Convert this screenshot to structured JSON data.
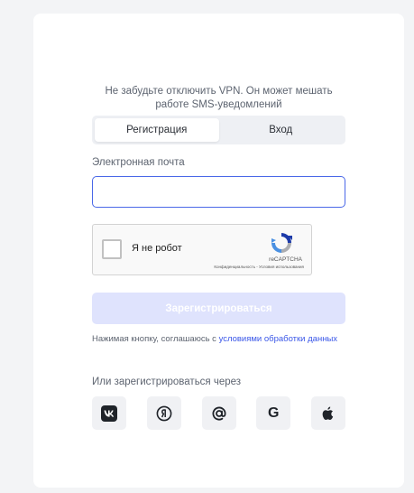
{
  "notice": {
    "line1": "Не забудьте отключить VPN. Он может мешать",
    "line2": "работе SMS-уведомлений"
  },
  "tabs": [
    {
      "label": "Регистрация",
      "active": true
    },
    {
      "label": "Вход",
      "active": false
    }
  ],
  "email": {
    "label": "Электронная почта",
    "value": "",
    "placeholder": ""
  },
  "recaptcha": {
    "label": "Я не робот",
    "brand": "reCAPTCHA",
    "terms": "Конфиденциальность - Условия использования"
  },
  "submit_label": "Зарегистрироваться",
  "consent": {
    "text": "Нажимая кнопку, соглашаюсь с",
    "link": "условиями обработки данных"
  },
  "social": {
    "label": "Или зарегистрироваться через",
    "providers": [
      {
        "name": "ВКонтакте",
        "icon": "vk-icon"
      },
      {
        "name": "Яндекс",
        "icon": "yandex-icon"
      },
      {
        "name": "Mail.ru",
        "icon": "mailru-icon"
      },
      {
        "name": "Google",
        "icon": "google-icon",
        "glyph": "G"
      },
      {
        "name": "Apple",
        "icon": "apple-icon"
      }
    ]
  },
  "colors": {
    "accent": "#4a68e8",
    "link": "#3a57e8",
    "button_disabled": "#dfe3fd",
    "card": "#ffffff",
    "background": "#f3f4f6"
  }
}
